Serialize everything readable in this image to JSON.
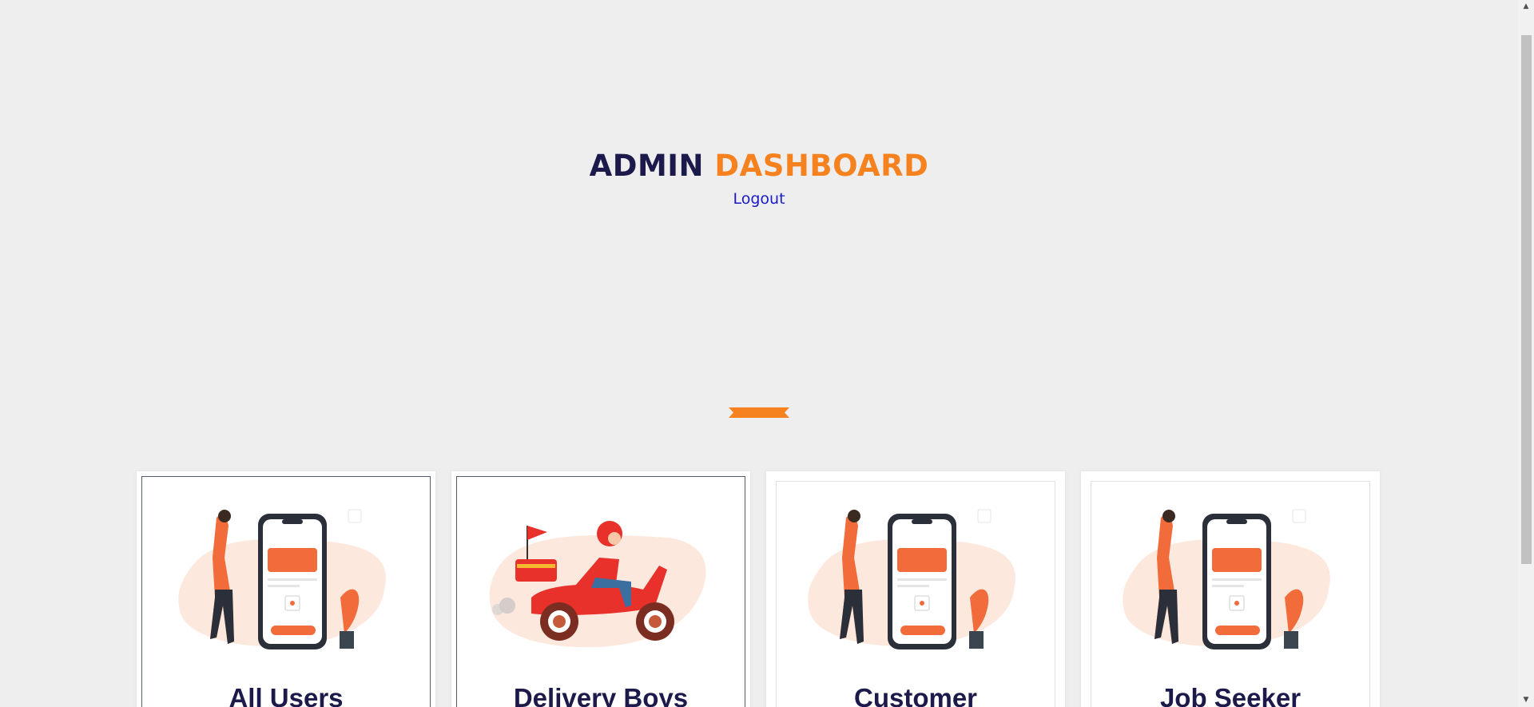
{
  "header": {
    "title_part1": "ADMIN",
    "title_part2": "DASHBOARD",
    "logout_label": "Logout"
  },
  "colors": {
    "navy": "#1c1a4a",
    "orange": "#f5821f",
    "link": "#1a1ac8",
    "background": "#eeeeee"
  },
  "cards": [
    {
      "label": "All Users",
      "icon": "payment-phone-illustration"
    },
    {
      "label": "Delivery Boys",
      "icon": "delivery-scooter-illustration"
    },
    {
      "label": "Customer",
      "icon": "payment-phone-illustration"
    },
    {
      "label": "Job Seeker",
      "icon": "payment-phone-illustration"
    }
  ],
  "scrollbar": {
    "up_icon": "▲",
    "down_icon": "▼"
  }
}
